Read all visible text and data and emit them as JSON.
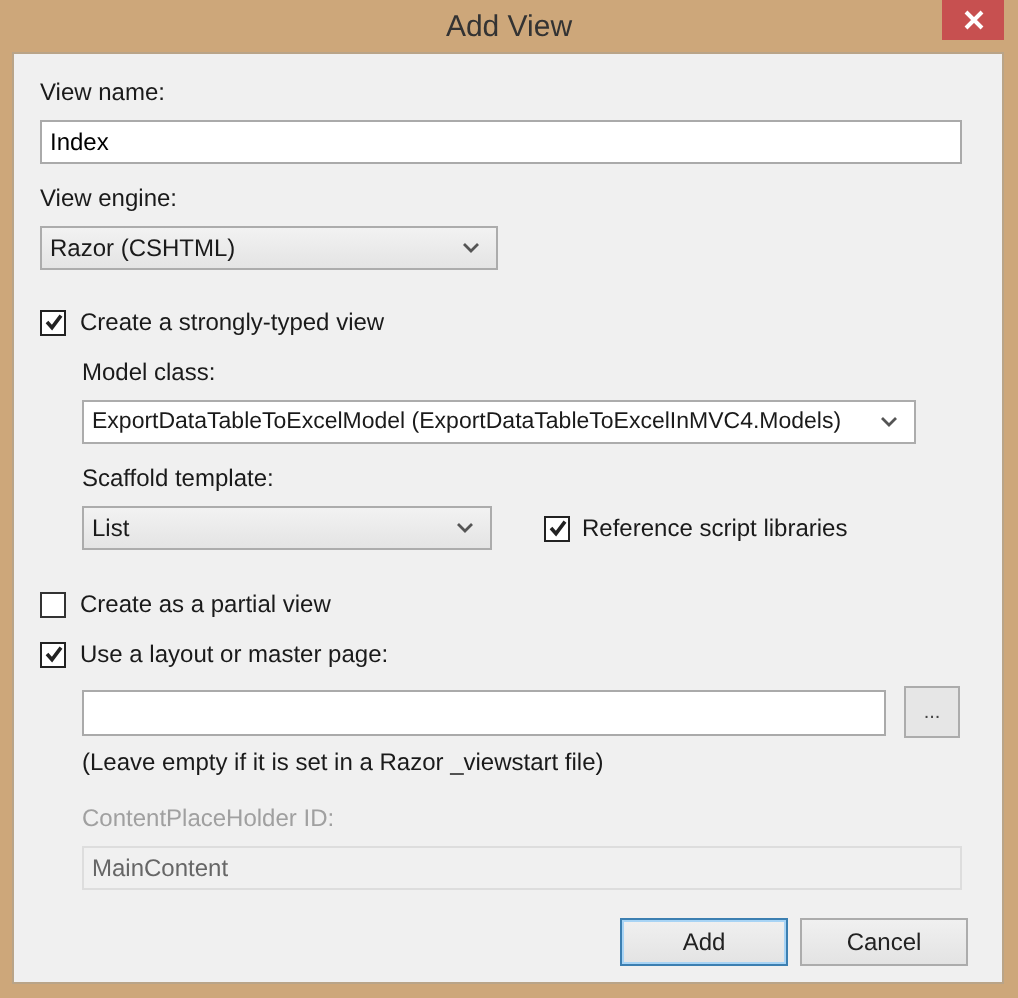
{
  "window": {
    "title": "Add View"
  },
  "view_name": {
    "label": "View name:",
    "value": "Index"
  },
  "view_engine": {
    "label": "View engine:",
    "value": "Razor (CSHTML)"
  },
  "strongly_typed": {
    "label": "Create a strongly-typed view",
    "checked": true
  },
  "model_class": {
    "label": "Model class:",
    "value": "ExportDataTableToExcelModel (ExportDataTableToExcelInMVC4.Models)"
  },
  "scaffold_template": {
    "label": "Scaffold template:",
    "value": "List"
  },
  "reference_scripts": {
    "label": "Reference script libraries",
    "checked": true
  },
  "partial_view": {
    "label": "Create as a partial view",
    "checked": false
  },
  "use_layout": {
    "label": "Use a layout or master page:",
    "checked": true
  },
  "layout": {
    "browse": "...",
    "hint": "(Leave empty if it is set in a Razor _viewstart file)"
  },
  "content_placeholder": {
    "label": "ContentPlaceHolder ID:",
    "value": "MainContent",
    "disabled": true
  },
  "buttons": [
    {
      "label": "Add",
      "default": true
    },
    {
      "label": "Cancel",
      "default": false
    }
  ]
}
